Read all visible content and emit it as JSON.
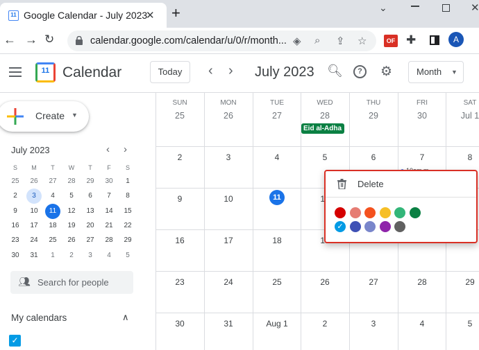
{
  "browser": {
    "tab_title": "Google Calendar - July 2023",
    "favicon_text": "11",
    "close_tab": "✕",
    "new_tab": "+",
    "url": "calendar.google.com/calendar/u/0/r/month...",
    "extension_red_label": "OF",
    "avatar_letter": "A"
  },
  "header": {
    "app_title": "Calendar",
    "logo_number": "11",
    "today_label": "Today",
    "month_label": "July 2023",
    "view_label": "Month"
  },
  "sidebar": {
    "create_label": "Create",
    "mini_title": "July 2023",
    "mini_dow": [
      "S",
      "M",
      "T",
      "W",
      "T",
      "F",
      "S"
    ],
    "mini_weeks": [
      [
        "25",
        "26",
        "27",
        "28",
        "29",
        "30",
        "1"
      ],
      [
        "2",
        "3",
        "4",
        "5",
        "6",
        "7",
        "8"
      ],
      [
        "9",
        "10",
        "11",
        "12",
        "13",
        "14",
        "15"
      ],
      [
        "16",
        "17",
        "18",
        "19",
        "20",
        "21",
        "22"
      ],
      [
        "23",
        "24",
        "25",
        "26",
        "27",
        "28",
        "29"
      ],
      [
        "30",
        "31",
        "1",
        "2",
        "3",
        "4",
        "5"
      ]
    ],
    "people_placeholder": "Search for people",
    "my_calendars_label": "My calendars"
  },
  "grid": {
    "dow": [
      "SUN",
      "MON",
      "TUE",
      "WED",
      "THU",
      "FRI",
      "SAT"
    ],
    "weeks": [
      [
        "25",
        "26",
        "27",
        "28",
        "29",
        "30",
        "Jul 1"
      ],
      [
        "2",
        "3",
        "4",
        "5",
        "6",
        "7",
        "8"
      ],
      [
        "9",
        "10",
        "11",
        "12",
        "13",
        "14",
        "15"
      ],
      [
        "16",
        "17",
        "18",
        "19",
        "20",
        "21",
        "22"
      ],
      [
        "23",
        "24",
        "25",
        "26",
        "27",
        "28",
        "29"
      ],
      [
        "30",
        "31",
        "Aug 1",
        "2",
        "3",
        "4",
        "5"
      ]
    ],
    "event_label": "Eid al-Adha",
    "timed_event_label": "10am m"
  },
  "popup": {
    "delete_label": "Delete",
    "colors_row1": [
      "#d50000",
      "#e67c73",
      "#f4511e",
      "#f6bf26",
      "#33b679",
      "#0b8043"
    ],
    "colors_row2": [
      "#039be5",
      "#3f51b5",
      "#7986cb",
      "#8e24aa",
      "#616161"
    ],
    "selected_color": "#039be5"
  }
}
